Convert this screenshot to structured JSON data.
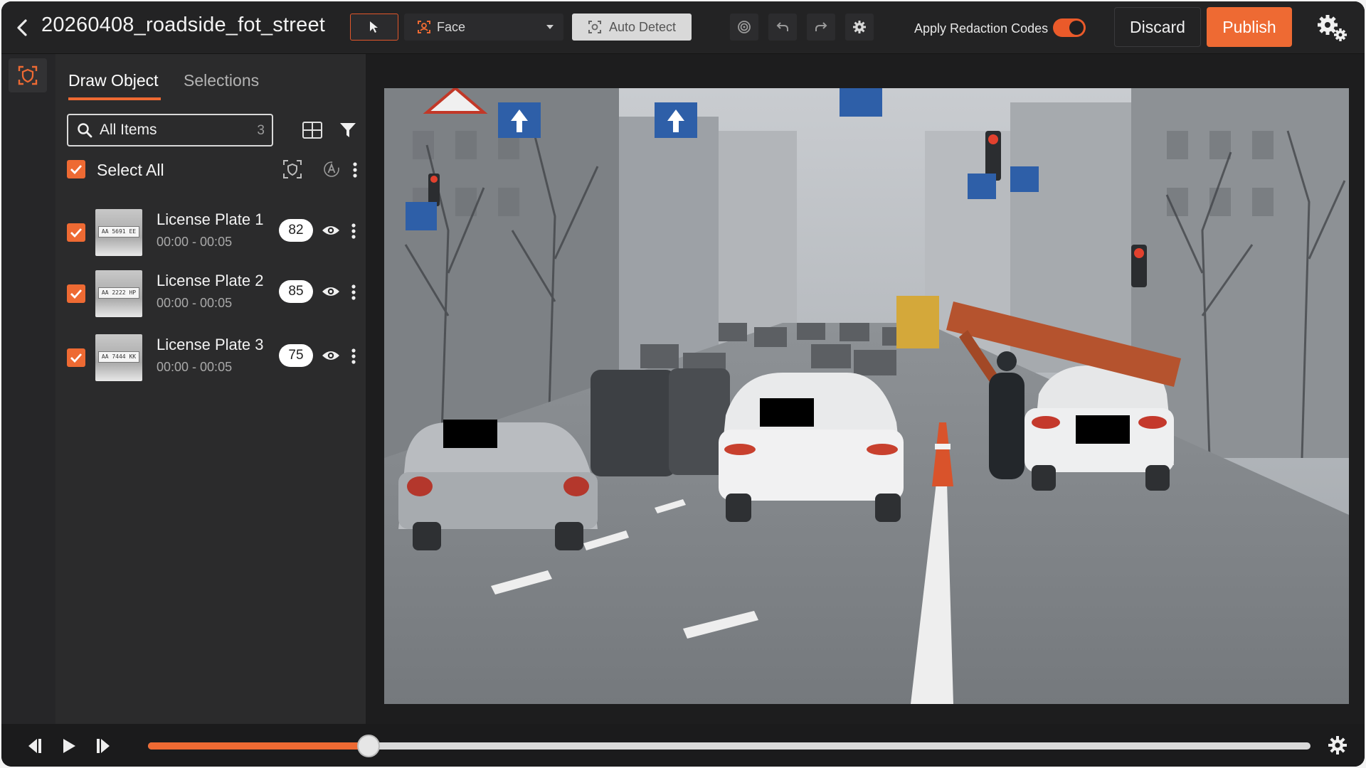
{
  "header": {
    "title": "20260408_roadside_fot_street",
    "tool_face_label": "Face",
    "auto_detect_label": "Auto Detect",
    "apply_redaction_label": "Apply Redaction Codes",
    "apply_redaction_on": true,
    "discard_label": "Discard",
    "publish_label": "Publish"
  },
  "panel": {
    "tabs": [
      {
        "label": "Draw Object",
        "active": true
      },
      {
        "label": "Selections",
        "active": false
      }
    ],
    "search": {
      "placeholder": "All Items",
      "count": "3"
    },
    "select_all_label": "Select All",
    "items": [
      {
        "name": "License Plate 1",
        "time": "00:00 - 00:05",
        "score": "82",
        "thumb_text": "AA 5691 EE",
        "checked": true
      },
      {
        "name": "License Plate 2",
        "time": "00:00 - 00:05",
        "score": "85",
        "thumb_text": "AA 2222 HP",
        "checked": true
      },
      {
        "name": "License Plate 3",
        "time": "00:00 - 00:05",
        "score": "75",
        "thumb_text": "AA 7444 KK",
        "checked": true
      }
    ]
  },
  "player": {
    "progress": 0.19
  },
  "colors": {
    "accent": "#ee6a33",
    "background": "#1f1f20",
    "panel": "#2b2b2c",
    "redaction_box": "#000000"
  },
  "icons": {
    "back": "chevron-left-icon",
    "select_tool": "cursor-icon",
    "face_tool": "face-scan-icon",
    "auto_detect": "auto-detect-icon",
    "target": "target-icon",
    "undo": "undo-icon",
    "redo": "redo-icon",
    "settings": "gear-icon",
    "settings_multi": "gears-icon",
    "grid": "grid-icon",
    "filter": "filter-icon",
    "eye": "eye-icon",
    "more": "kebab-icon"
  }
}
